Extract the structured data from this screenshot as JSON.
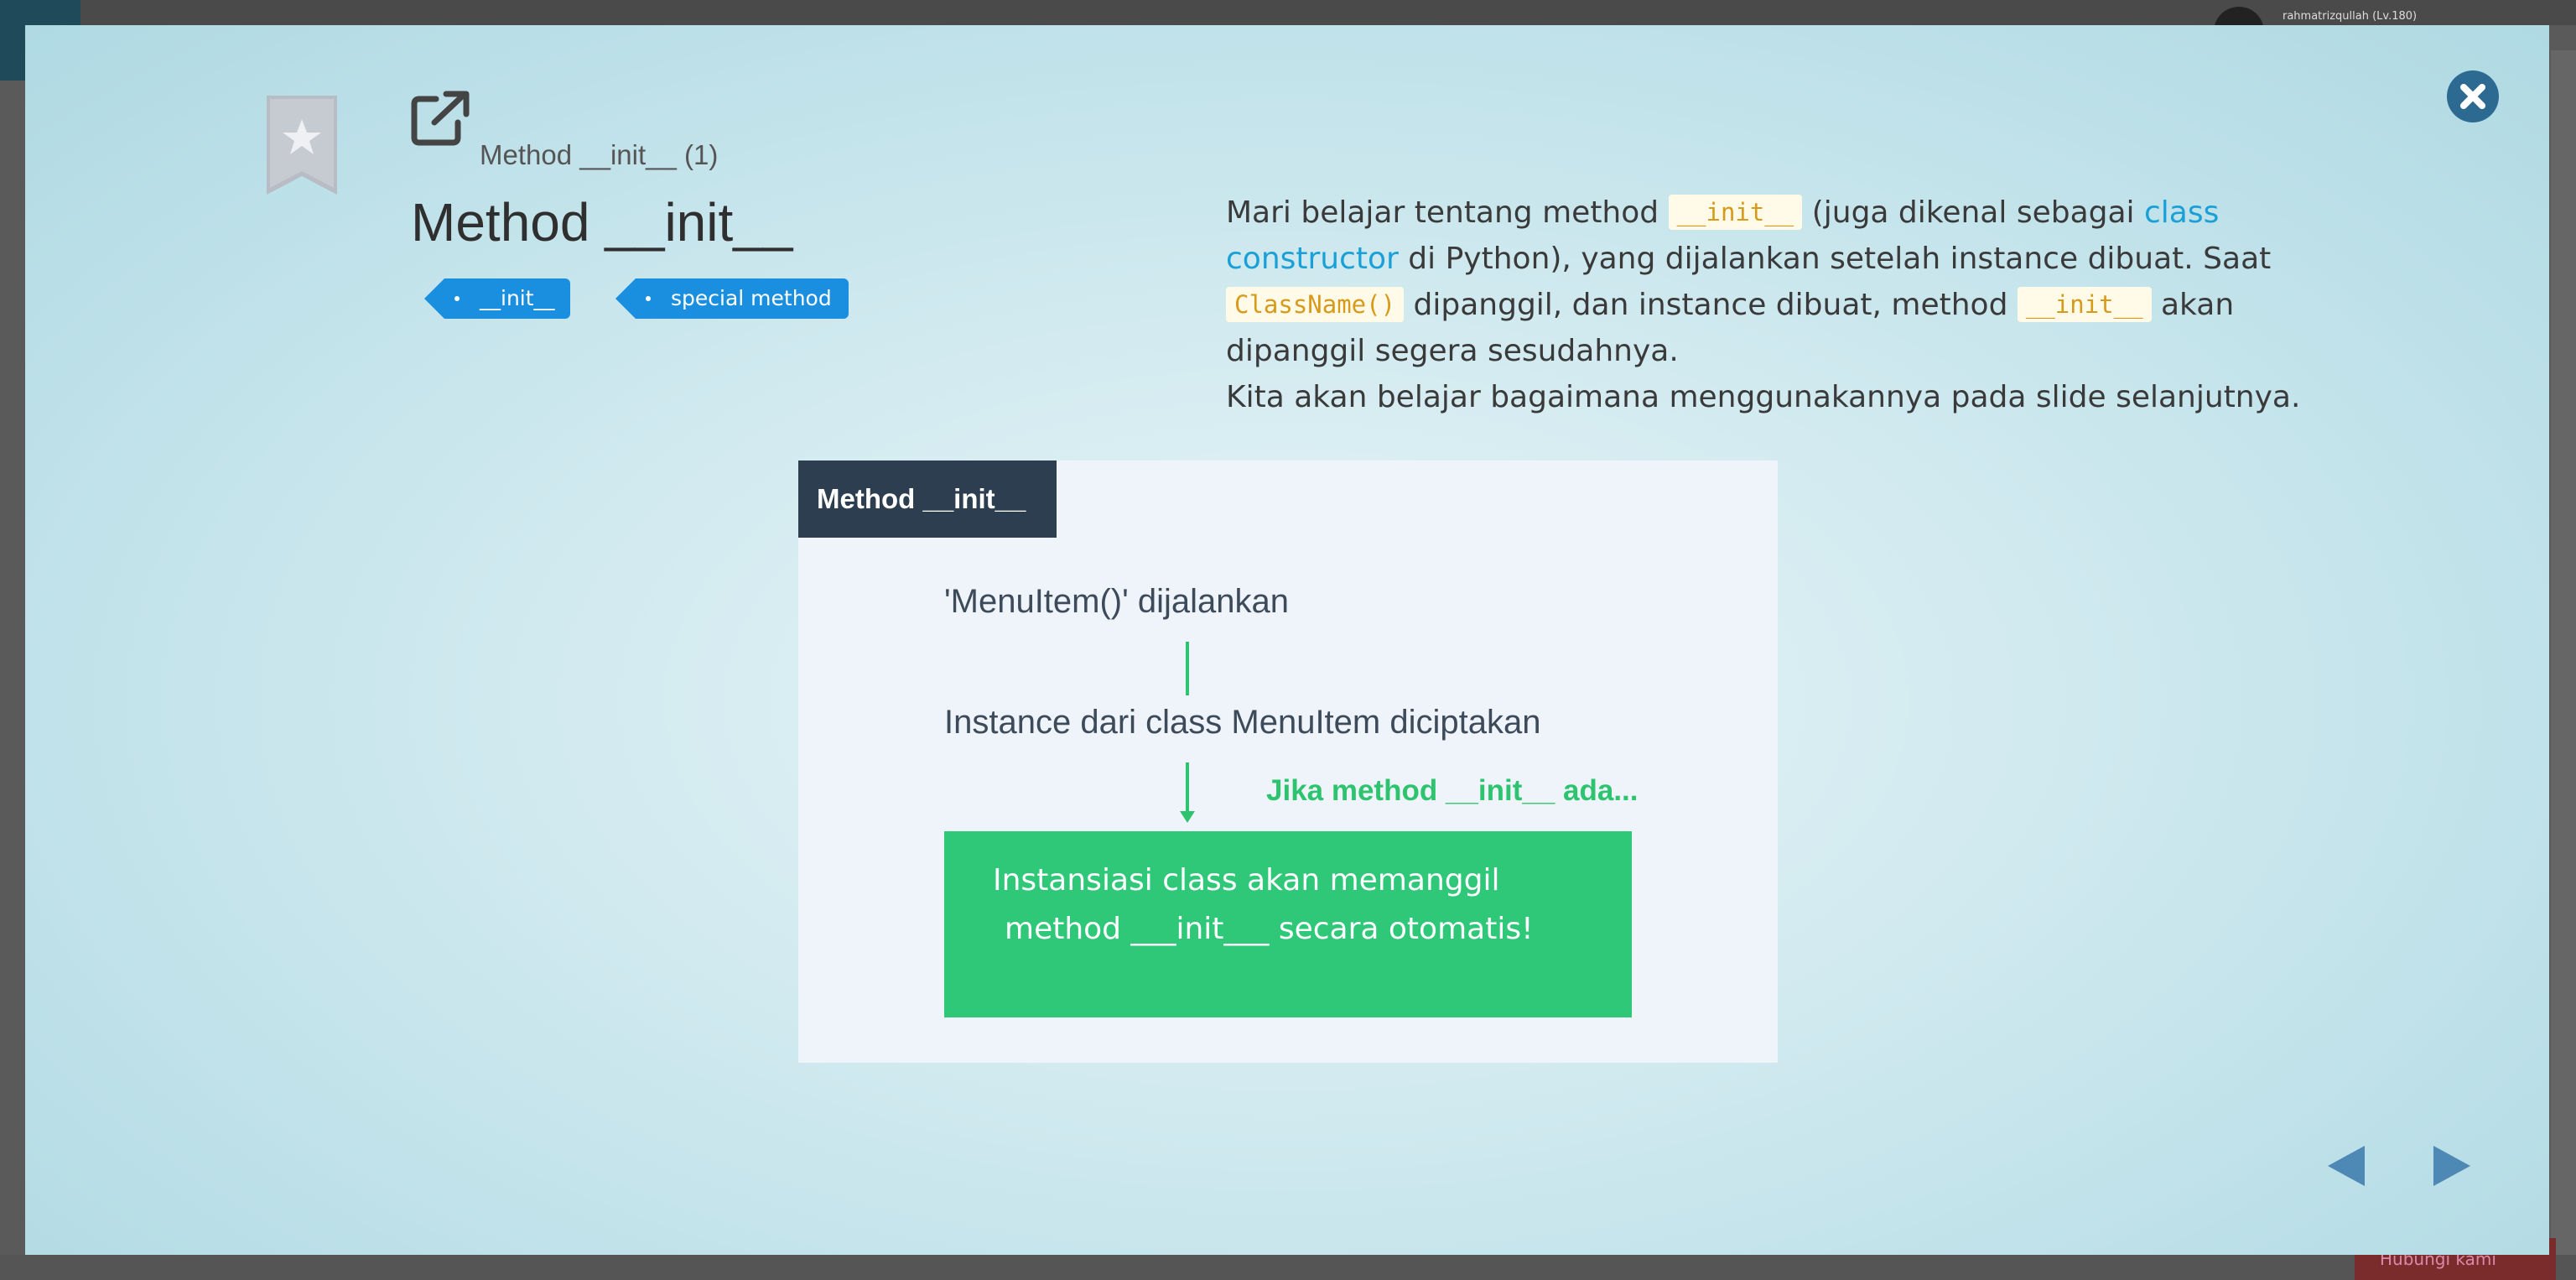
{
  "background": {
    "username": "rahmatrizqullah (Lv.180)",
    "bottom_button_label": "Hubungi kami"
  },
  "modal": {
    "breadcrumb": "Method __init__ (1)",
    "title": "Method __init__",
    "tags": [
      "__init__",
      "special method"
    ],
    "description": {
      "p1_a": "Mari belajar tentang method ",
      "code1": "__init__",
      "p1_b": " (juga dikenal sebagai ",
      "link": "class constructor",
      "p1_c": " di Python), yang dijalankan setelah instance dibuat. Saat ",
      "code2": "ClassName()",
      "p1_d": " dipanggil, dan instance dibuat, method ",
      "code3": "__init__",
      "p1_e": " akan dipanggil segera sesudahnya.",
      "p2": "Kita akan belajar bagaimana menggunakannya pada slide selanjutnya."
    },
    "diagram": {
      "header": "Method __init__",
      "step1": "'MenuItem()' dijalankan",
      "step2": "Instance dari class MenuItem diciptakan",
      "condition": "Jika method __init__ ada...",
      "box_line1": "Instansiasi class akan memanggil",
      "box_line2": "method ___init___ secara otomatis!"
    }
  },
  "colors": {
    "accent_blue": "#1a8fe0",
    "link": "#1aa0d6",
    "code_text": "#d79a1a",
    "diagram_green": "#2ec878",
    "diagram_header": "#2c3e50",
    "nav_arrow": "#4e88b5",
    "close_button": "#2d6a92"
  },
  "icons": {
    "bookmark": "bookmark-star-icon",
    "external": "external-link-icon",
    "close": "close-icon",
    "prev": "prev-arrow-icon",
    "next": "next-arrow-icon"
  }
}
